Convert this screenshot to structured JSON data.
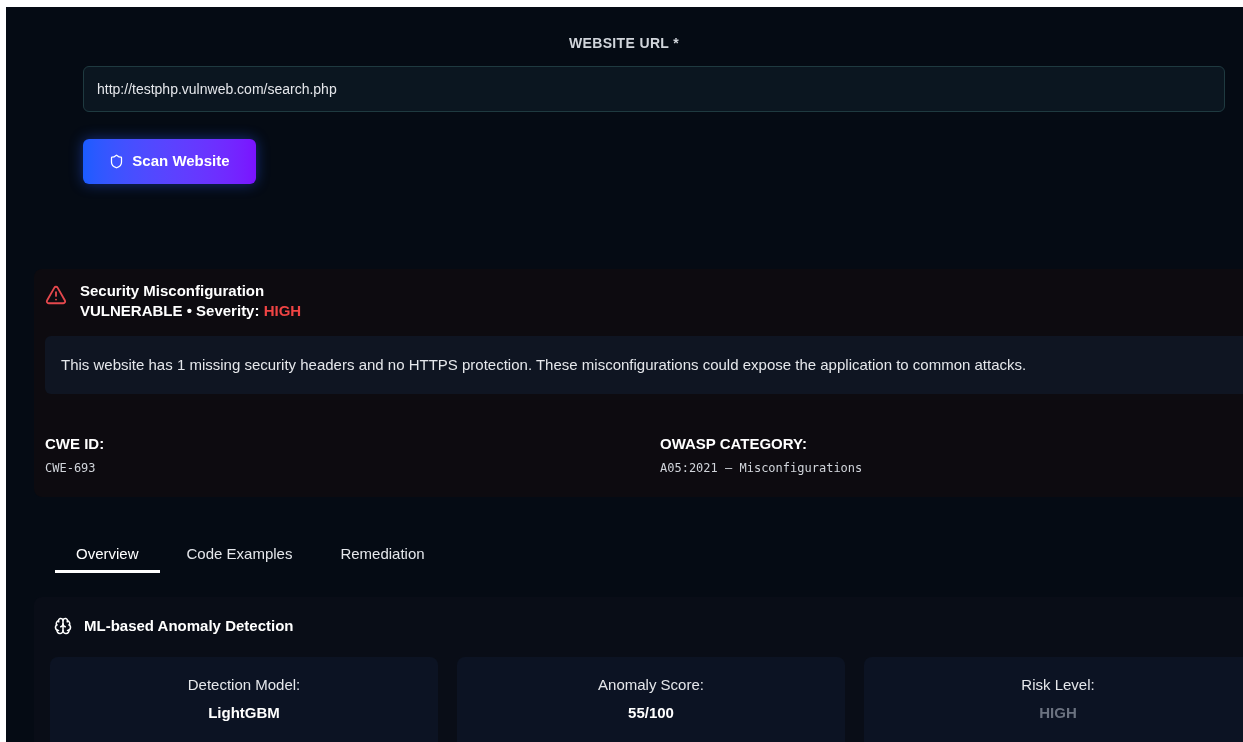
{
  "url_form": {
    "label": "WEBSITE URL *",
    "value": "http://testphp.vulnweb.com/search.php",
    "button": "Scan Website"
  },
  "finding": {
    "title": "Security Misconfiguration",
    "status": "VULNERABLE • Severity: ",
    "severity": "HIGH",
    "description": "This website has 1 missing security headers and no HTTPS protection. These misconfigurations could expose the application to common attacks.",
    "details": [
      {
        "label": "CWE ID:",
        "value": "CWE-693"
      },
      {
        "label": "OWASP CATEGORY:",
        "value": "A05:2021 – Misconfigurations"
      }
    ]
  },
  "tabs": [
    {
      "label": "Overview",
      "selected": true
    },
    {
      "label": "Code Examples",
      "selected": false
    },
    {
      "label": "Remediation",
      "selected": false
    }
  ],
  "ml_panel": {
    "title": "ML-based Anomaly Detection",
    "stats": [
      {
        "label": "Detection Model:",
        "value": "LightGBM",
        "muted": false
      },
      {
        "label": "Anomaly Score:",
        "value": "55/100",
        "muted": false
      },
      {
        "label": "Risk Level:",
        "value": "HIGH",
        "muted": true
      }
    ]
  }
}
